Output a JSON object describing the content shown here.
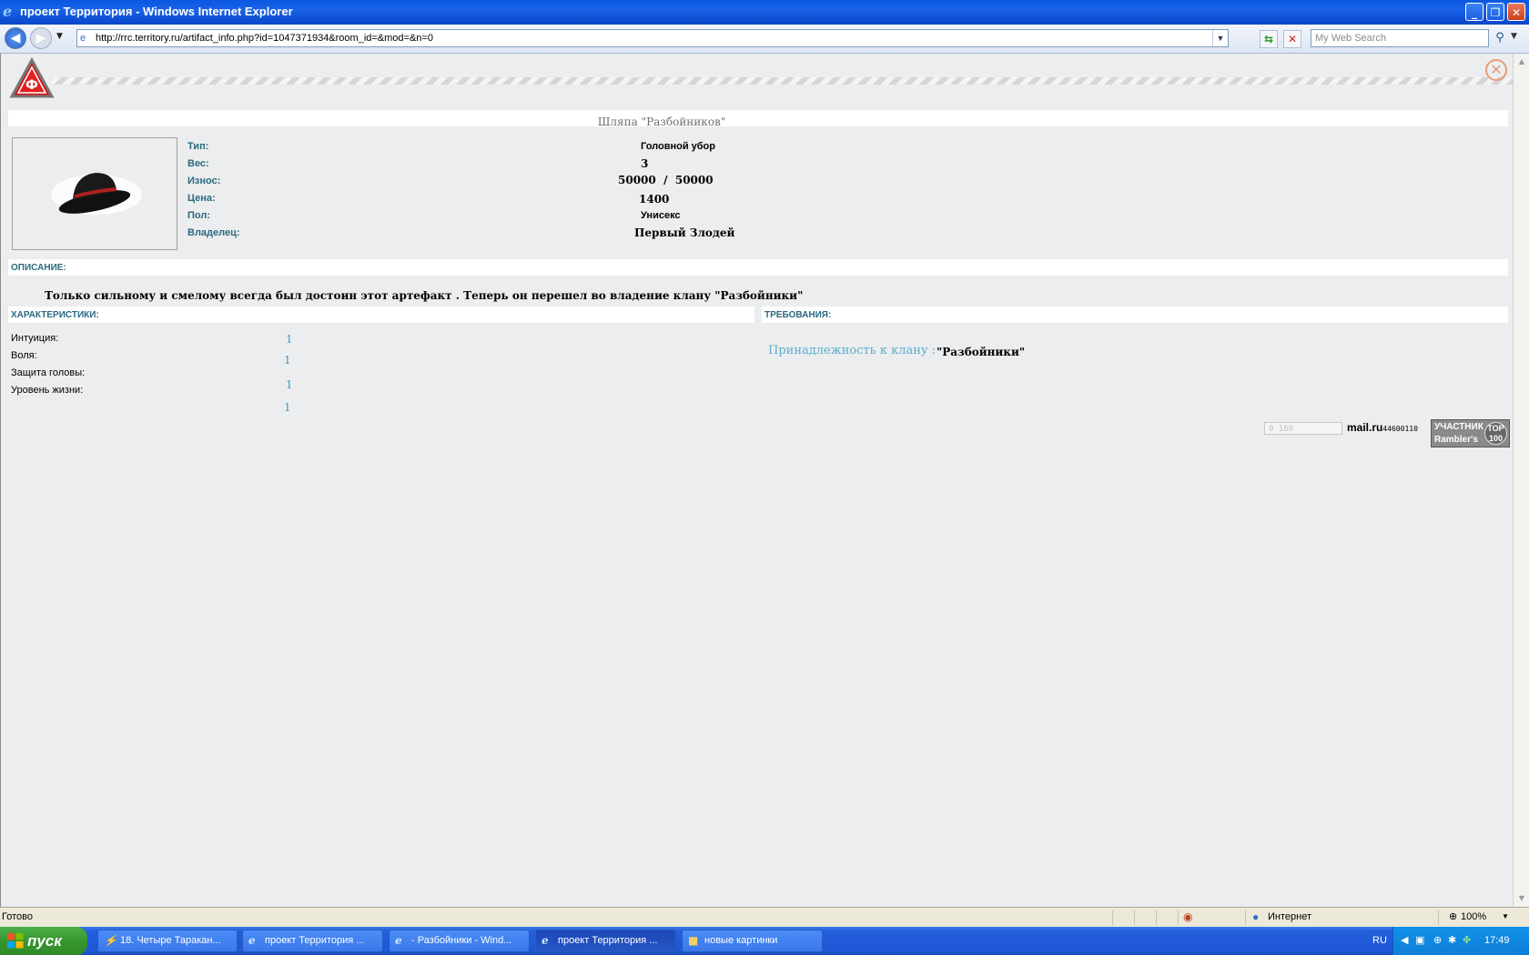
{
  "window": {
    "title": "проект Территория - Windows Internet Explorer",
    "min": "_",
    "max": "❐",
    "close": "✕"
  },
  "toolbar": {
    "url": "http://rrc.territory.ru/artifact_info.php?id=1047371934&room_id=&mod=&n=0",
    "search_placeholder": "My Web Search"
  },
  "item": {
    "title": "Шляпа \"Разбойников\"",
    "props": [
      {
        "label": "Тип:",
        "value": "Головной убор"
      },
      {
        "label": "Вес:",
        "value": "3"
      },
      {
        "label": "Износ:",
        "value": "50000  /  50000"
      },
      {
        "label": "Цена:",
        "value": "1400"
      },
      {
        "label": "Пол:",
        "value": "Унисекс"
      },
      {
        "label": "Владелец:",
        "value": "Первый Злодей"
      }
    ],
    "description_label": "ОПИСАНИЕ:",
    "description": "Только сильному и смелому всегда был достоин этот артефакт . Теперь он перешел  во владение клану \"Разбойники\""
  },
  "characteristics": {
    "label": "ХАРАКТЕРИСТИКИ:",
    "rows": [
      {
        "label": "Интуиция:",
        "value": "1"
      },
      {
        "label": "Воля:",
        "value": "1"
      },
      {
        "label": "Защита головы:",
        "value": ""
      },
      {
        "label": "Уровень жизни:",
        "value": "1"
      }
    ],
    "extra_value": "1"
  },
  "requirements": {
    "label": "ТРЕБОВАНИЯ:",
    "clan_label": "Принадлежность к клану :",
    "clan_value": "\"Разбойники\""
  },
  "counters": {
    "counter1": "0 160",
    "mail_label": "mail.ru",
    "mail_number": "44600110",
    "rambler_label": "УЧАСТНИК",
    "rambler_brand": "Rambler's",
    "rambler_top": "TOP 100"
  },
  "status": {
    "text": "Готово",
    "zone": "Интернет",
    "zoom": "100%"
  },
  "taskbar": {
    "start": "пуск",
    "tasks": [
      {
        "label": "18. Четыре Таракан...",
        "icon": "winamp-icon"
      },
      {
        "label": "проект Территория ...",
        "icon": "ie-icon"
      },
      {
        "label": "- Разбойники - Wind...",
        "icon": "ie-icon"
      },
      {
        "label": "проект Территория ...",
        "icon": "ie-icon"
      },
      {
        "label": "новые картинки",
        "icon": "folder-icon"
      }
    ],
    "lang": "RU",
    "time": "17:49"
  }
}
